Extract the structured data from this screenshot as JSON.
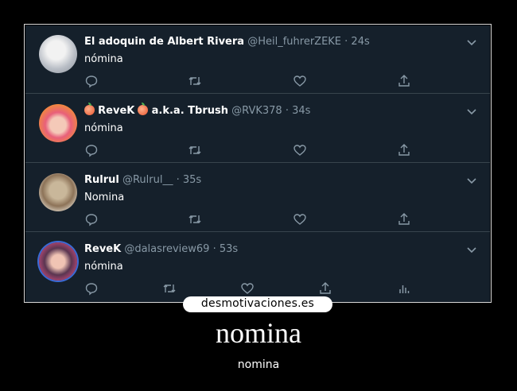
{
  "tweets": [
    {
      "name": "El adoquin de Albert Rivera",
      "handle": "@Heil_fuhrerZEKE",
      "time": "· 24s",
      "text": "nómina",
      "avatar_color": "#cfd3d8"
    },
    {
      "name": "ReveK",
      "name_suffix": "a.k.a. Tbrush",
      "handle": "@RVK378",
      "time": "· 34s",
      "text": "nómina",
      "avatar_color": "#f07d4a"
    },
    {
      "name": "Rulrul",
      "handle": "@Rulrul__",
      "time": "· 35s",
      "text": "Nomina",
      "avatar_color": "#b59a78"
    },
    {
      "name": "ReveK",
      "handle": "@dalasreview69",
      "time": "· 53s",
      "text": "nómina",
      "avatar_color": "#6a4e6e"
    }
  ],
  "icons": [
    "reply-icon",
    "retweet-icon",
    "like-icon",
    "share-icon",
    "analytics-icon",
    "chevron-down-icon"
  ],
  "colors": {
    "background": "#15202b",
    "divider": "#38444d",
    "secondary_text": "#8899a6"
  },
  "brand": "desmotivaciones.es",
  "caption": {
    "title": "nomina",
    "subtitle": "nomina"
  }
}
